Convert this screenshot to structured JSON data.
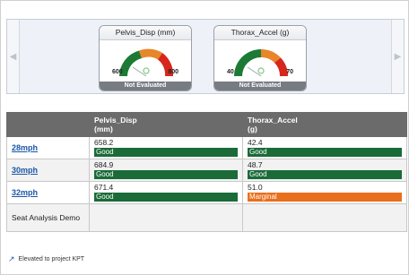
{
  "carousel": {
    "prev_icon": "chevron-left-icon",
    "next_icon": "chevron-right-icon",
    "gauges": [
      {
        "title": "Pelvis_Disp (mm)",
        "min": "600",
        "max": "800",
        "status": "Not Evaluated"
      },
      {
        "title": "Thorax_Accel (g)",
        "min": "40",
        "max": "70",
        "status": "Not Evaluated"
      }
    ],
    "colors": {
      "green": "#1d7a35",
      "orange": "#e8862a",
      "red": "#d7261b"
    }
  },
  "table": {
    "headers": [
      "",
      "Pelvis_Disp\n(mm)",
      "Thorax_Accel\n(g)"
    ],
    "header_col1_line1": "Pelvis_Disp",
    "header_col1_line2": "(mm)",
    "header_col2_line1": "Thorax_Accel",
    "header_col2_line2": "(g)",
    "rows": [
      {
        "label": "28mph",
        "pelvis": "658.2",
        "pelvis_rating": "Good",
        "thorax": "42.4",
        "thorax_rating": "Good"
      },
      {
        "label": "30mph",
        "pelvis": "684.9",
        "pelvis_rating": "Good",
        "thorax": "48.7",
        "thorax_rating": "Good"
      },
      {
        "label": "32mph",
        "pelvis": "671.4",
        "pelvis_rating": "Good",
        "thorax": "51.0",
        "thorax_rating": "Marginal"
      }
    ],
    "footer_row_label": "Seat Analysis Demo",
    "rating_colors": {
      "Good": "#1a6b38",
      "Marginal": "#e86f1c"
    }
  },
  "footer": {
    "icon": "arrow-up-right-icon",
    "text": "Elevated to project KPT"
  }
}
